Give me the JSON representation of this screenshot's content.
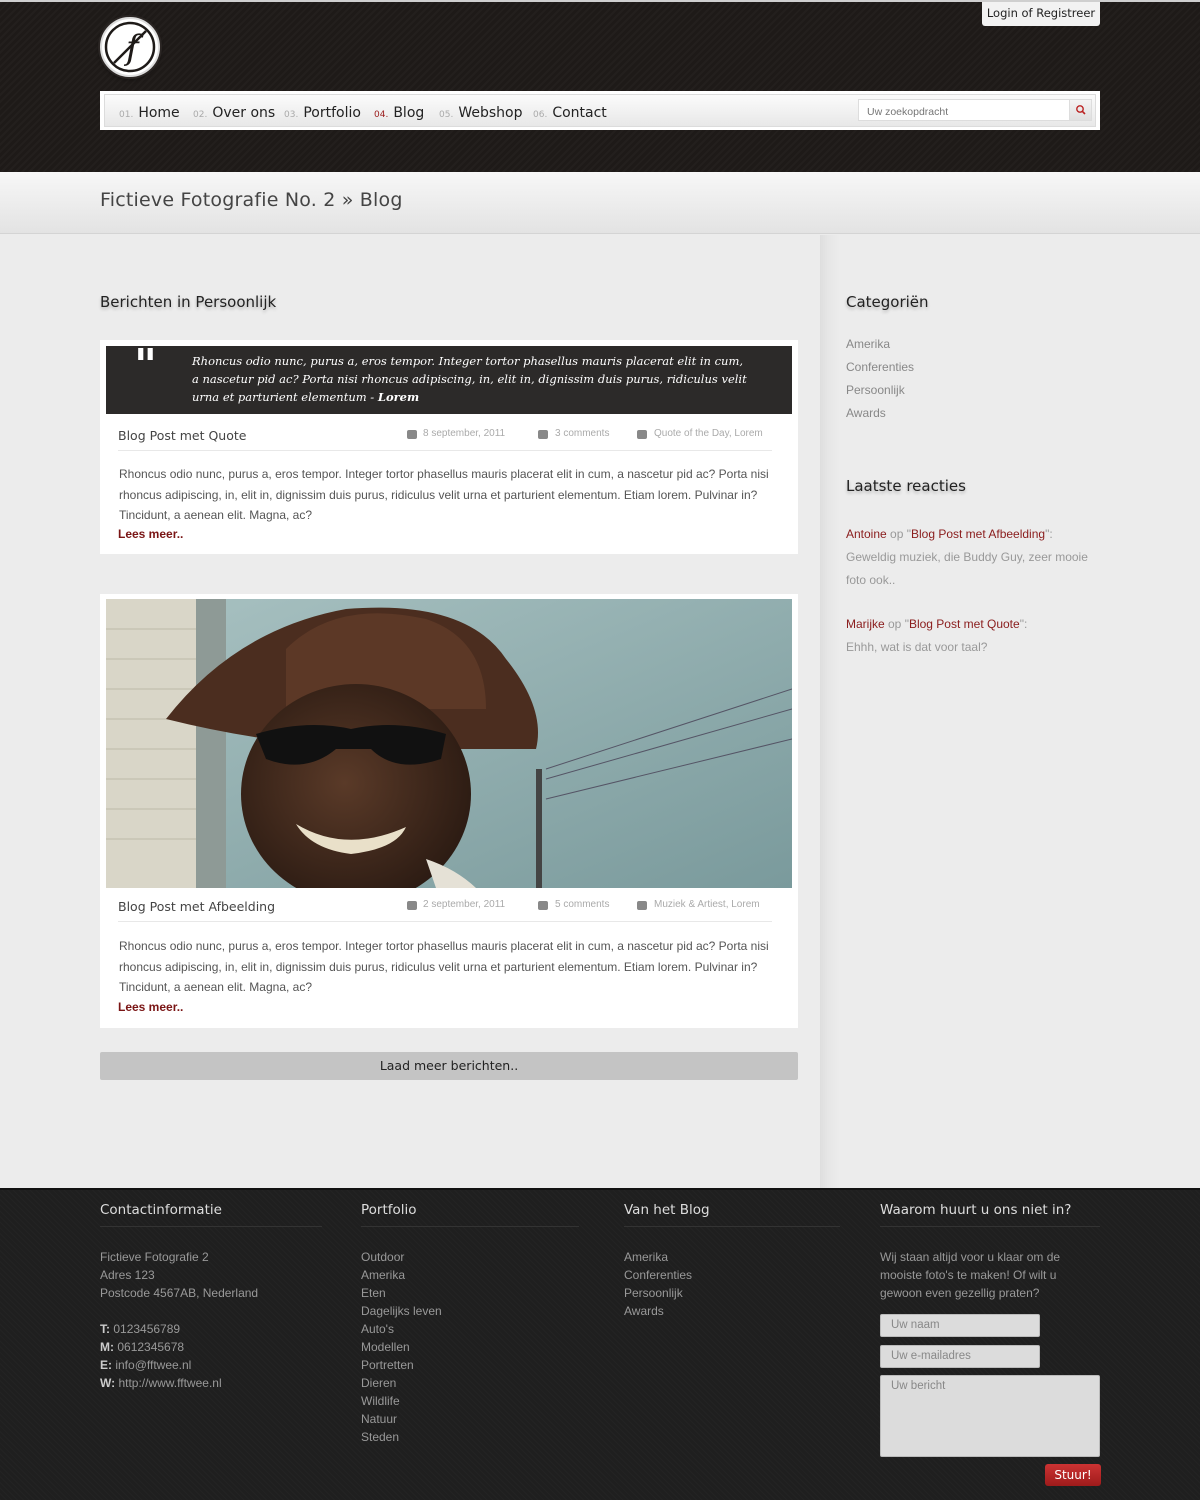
{
  "header": {
    "login_label": "Login of Registreer",
    "logo_letter": "f",
    "search_placeholder": "Uw zoekopdracht"
  },
  "nav": [
    {
      "num": "01.",
      "label": "Home"
    },
    {
      "num": "02.",
      "label": "Over ons"
    },
    {
      "num": "03.",
      "label": "Portfolio"
    },
    {
      "num": "04.",
      "label": "Blog",
      "active": true
    },
    {
      "num": "05.",
      "label": "Webshop"
    },
    {
      "num": "06.",
      "label": "Contact"
    }
  ],
  "page_title": "Fictieve Fotografie No. 2 » Blog",
  "main": {
    "heading": "Berichten in Persoonlijk",
    "posts": [
      {
        "quote": "Rhoncus odio nunc, purus a, eros tempor. Integer tortor phasellus mauris placerat elit in cum, a nascetur pid ac? Porta nisi rhoncus adipiscing, in, elit in, dignissim duis purus, ridiculus velit urna et parturient elementum - ",
        "quote_author": "Lorem",
        "title": "Blog Post met Quote",
        "date": "8 september, 2011",
        "comments": "3 comments",
        "tags": "Quote of the Day, Lorem",
        "excerpt": "Rhoncus odio nunc, purus a, eros tempor. Integer tortor phasellus mauris placerat elit in cum, a nascetur pid ac? Porta nisi rhoncus adipiscing, in, elit in, dignissim duis purus, ridiculus velit urna et parturient elementum. Etiam lorem. Pulvinar in? Tincidunt, a aenean elit. Magna, ac?",
        "more": "Lees meer.."
      },
      {
        "title": "Blog Post met Afbeelding",
        "date": "2 september, 2011",
        "comments": "5 comments",
        "tags": "Muziek & Artiest, Lorem",
        "excerpt": "Rhoncus odio nunc, purus a, eros tempor. Integer tortor phasellus mauris placerat elit in cum, a nascetur pid ac? Porta nisi rhoncus adipiscing, in, elit in, dignissim duis purus, ridiculus velit urna et parturient elementum. Etiam lorem. Pulvinar in? Tincidunt, a aenean elit. Magna, ac?",
        "more": "Lees meer.."
      }
    ],
    "load_more": "Laad meer berichten.."
  },
  "sidebar": {
    "categories_title": "Categoriën",
    "categories": [
      "Amerika",
      "Conferenties",
      "Persoonlijk",
      "Awards"
    ],
    "comments_title": "Laatste reacties",
    "comments": [
      {
        "author": "Antoine",
        "op": " op \"",
        "post": "Blog Post met Afbeelding",
        "close": "\":",
        "text": "Geweldig muziek, die Buddy Guy, zeer mooie foto ook.."
      },
      {
        "author": "Marijke",
        "op": " op \"",
        "post": "Blog Post met Quote",
        "close": "\":",
        "text": "Ehhh, wat is dat voor taal?"
      }
    ]
  },
  "footer": {
    "contact_title": "Contactinformatie",
    "contact_lines": [
      "Fictieve Fotografie 2",
      "Adres 123",
      "Postcode 4567AB, Nederland"
    ],
    "contact_info": [
      {
        "key": "T:",
        "value": "0123456789"
      },
      {
        "key": "M:",
        "value": "0612345678"
      },
      {
        "key": "E:",
        "value": "info@fftwee.nl"
      },
      {
        "key": "W:",
        "value": "http://www.fftwee.nl"
      }
    ],
    "portfolio_title": "Portfolio",
    "portfolio_links": [
      "Outdoor",
      "Amerika",
      "Eten",
      "Dagelijks leven",
      "Auto's",
      "Modellen",
      "Portretten",
      "Dieren",
      "Wildlife",
      "Natuur",
      "Steden"
    ],
    "blog_title": "Van het Blog",
    "blog_links": [
      "Amerika",
      "Conferenties",
      "Persoonlijk",
      "Awards"
    ],
    "form_title": "Waarom huurt u ons niet in?",
    "form_text": "Wij staan altijd voor u klaar om de mooiste foto's te maken! Of wilt u gewoon even gezellig praten?",
    "name_placeholder": "Uw naam",
    "email_placeholder": "Uw e-mailadres",
    "message_placeholder": "Uw bericht",
    "submit_label": "Stuur!"
  },
  "colors": {
    "accent": "#8a1c1c",
    "header_bg": "#1e1a18",
    "footer_bg": "#1f1f1f"
  }
}
